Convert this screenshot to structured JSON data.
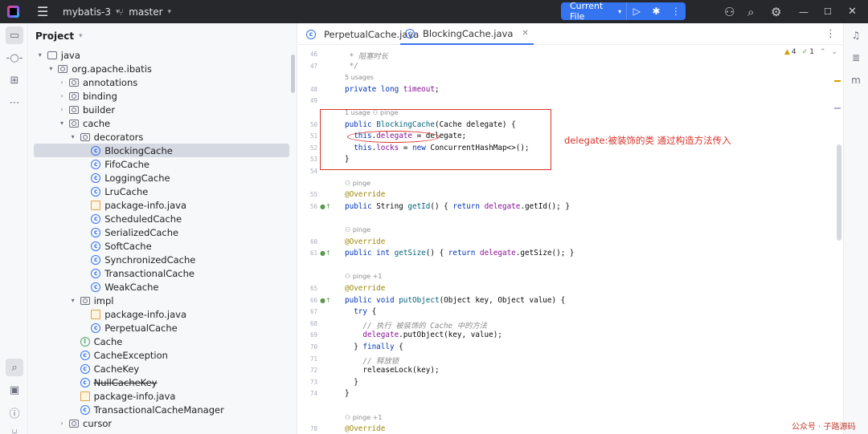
{
  "titlebar": {
    "project": "mybatis-3",
    "branch": "master",
    "run_config": "Current File"
  },
  "project_panel": {
    "title": "Project",
    "tree": [
      {
        "label": "java",
        "icon": "folder",
        "indent": 3,
        "arrow": "down"
      },
      {
        "label": "org.apache.ibatis",
        "icon": "pkg",
        "indent": 4,
        "arrow": "down"
      },
      {
        "label": "annotations",
        "icon": "pkg",
        "indent": 5,
        "arrow": "right"
      },
      {
        "label": "binding",
        "icon": "pkg",
        "indent": 5,
        "arrow": "right"
      },
      {
        "label": "builder",
        "icon": "pkg",
        "indent": 5,
        "arrow": "right"
      },
      {
        "label": "cache",
        "icon": "pkg",
        "indent": 5,
        "arrow": "down"
      },
      {
        "label": "decorators",
        "icon": "pkg",
        "indent": 6,
        "arrow": "down"
      },
      {
        "label": "BlockingCache",
        "icon": "cls",
        "indent": 7,
        "arrow": "",
        "selected": true
      },
      {
        "label": "FifoCache",
        "icon": "cls",
        "indent": 7,
        "arrow": ""
      },
      {
        "label": "LoggingCache",
        "icon": "cls",
        "indent": 7,
        "arrow": ""
      },
      {
        "label": "LruCache",
        "icon": "cls",
        "indent": 7,
        "arrow": ""
      },
      {
        "label": "package-info.java",
        "icon": "file",
        "indent": 7,
        "arrow": ""
      },
      {
        "label": "ScheduledCache",
        "icon": "cls",
        "indent": 7,
        "arrow": ""
      },
      {
        "label": "SerializedCache",
        "icon": "cls",
        "indent": 7,
        "arrow": ""
      },
      {
        "label": "SoftCache",
        "icon": "cls",
        "indent": 7,
        "arrow": ""
      },
      {
        "label": "SynchronizedCache",
        "icon": "cls",
        "indent": 7,
        "arrow": ""
      },
      {
        "label": "TransactionalCache",
        "icon": "cls",
        "indent": 7,
        "arrow": ""
      },
      {
        "label": "WeakCache",
        "icon": "cls",
        "indent": 7,
        "arrow": ""
      },
      {
        "label": "impl",
        "icon": "pkg",
        "indent": 6,
        "arrow": "down"
      },
      {
        "label": "package-info.java",
        "icon": "file",
        "indent": 7,
        "arrow": ""
      },
      {
        "label": "PerpetualCache",
        "icon": "cls",
        "indent": 7,
        "arrow": ""
      },
      {
        "label": "Cache",
        "icon": "intf",
        "indent": 6,
        "arrow": ""
      },
      {
        "label": "CacheException",
        "icon": "cls",
        "indent": 6,
        "arrow": ""
      },
      {
        "label": "CacheKey",
        "icon": "cls",
        "indent": 6,
        "arrow": ""
      },
      {
        "label": "NullCacheKey",
        "icon": "cls",
        "indent": 6,
        "arrow": "",
        "strike": true
      },
      {
        "label": "package-info.java",
        "icon": "file",
        "indent": 6,
        "arrow": ""
      },
      {
        "label": "TransactionalCacheManager",
        "icon": "cls",
        "indent": 6,
        "arrow": ""
      },
      {
        "label": "cursor",
        "icon": "pkg",
        "indent": 5,
        "arrow": "right"
      }
    ]
  },
  "tabs": [
    {
      "label": "PerpetualCache.java",
      "active": false
    },
    {
      "label": "BlockingCache.java",
      "active": true
    }
  ],
  "inspection": {
    "warnings": "4",
    "ok": "1"
  },
  "editor": {
    "lines": [
      {
        "no": "46",
        "hint": "",
        "html": "<span class=\"cm\"> * 阻塞时长</span>"
      },
      {
        "no": "47",
        "hint": "",
        "html": "<span class=\"cm\"> */</span>"
      },
      {
        "no": "",
        "hint": "5 usages",
        "html": ""
      },
      {
        "no": "48",
        "hint": "",
        "html": "<span class=\"kw\">private long</span> <span class=\"fld\">timeout</span>;"
      },
      {
        "no": "49",
        "hint": "",
        "html": ""
      },
      {
        "no": "",
        "hint": "1 usage   ⚇ pinge",
        "html": ""
      },
      {
        "no": "50",
        "hint": "",
        "html": "<span class=\"kw\">public</span> <span class=\"mth\">BlockingCache</span>(Cache delegate) {"
      },
      {
        "no": "51",
        "hint": "",
        "html": "  <span class=\"kw\">this</span>.<span class=\"fld\">delegate</span> = delegate;"
      },
      {
        "no": "52",
        "hint": "",
        "html": "  <span class=\"kw\">this</span>.<span class=\"fld\">locks</span> = <span class=\"kw\">new</span> ConcurrentHashMap&lt;&gt;();"
      },
      {
        "no": "53",
        "hint": "",
        "html": "}"
      },
      {
        "no": "54",
        "hint": "",
        "html": ""
      },
      {
        "no": "",
        "hint": "⚇ pinge",
        "html": ""
      },
      {
        "no": "55",
        "hint": "",
        "html": "<span class=\"ann\">@Override</span>"
      },
      {
        "no": "56",
        "hint": "",
        "icon": "●↑",
        "html": "<span class=\"kw\">public</span> String <span class=\"mth\">getId</span>() { <span class=\"kw\">return</span> <span class=\"fld\">delegate</span>.getId(); }"
      },
      {
        "no": "",
        "hint": "",
        "html": ""
      },
      {
        "no": "",
        "hint": "⚇ pinge",
        "html": ""
      },
      {
        "no": "60",
        "hint": "",
        "html": "<span class=\"ann\">@Override</span>"
      },
      {
        "no": "61",
        "hint": "",
        "icon": "●↑",
        "html": "<span class=\"kw\">public int</span> <span class=\"mth\">getSize</span>() { <span class=\"kw\">return</span> <span class=\"fld\">delegate</span>.getSize(); }"
      },
      {
        "no": "",
        "hint": "",
        "html": ""
      },
      {
        "no": "",
        "hint": "⚇ pinge +1",
        "html": ""
      },
      {
        "no": "65",
        "hint": "",
        "html": "<span class=\"ann\">@Override</span>"
      },
      {
        "no": "66",
        "hint": "",
        "icon": "●↑",
        "html": "<span class=\"kw\">public void</span> <span class=\"mth\">putObject</span>(Object key, Object value) {"
      },
      {
        "no": "67",
        "hint": "",
        "html": "  <span class=\"kw\">try</span> {"
      },
      {
        "no": "68",
        "hint": "",
        "html": "    <span class=\"cm\">// 执行 被装饰的 Cache 中的方法</span>"
      },
      {
        "no": "69",
        "hint": "",
        "html": "    <span class=\"fld\">delegate</span>.putObject(key, value);"
      },
      {
        "no": "70",
        "hint": "",
        "html": "  } <span class=\"kw\">finally</span> {"
      },
      {
        "no": "71",
        "hint": "",
        "html": "    <span class=\"cm\">// 释放锁</span>"
      },
      {
        "no": "72",
        "hint": "",
        "html": "    releaseLock(key);"
      },
      {
        "no": "73",
        "hint": "",
        "html": "  }"
      },
      {
        "no": "74",
        "hint": "",
        "html": "}"
      },
      {
        "no": "",
        "hint": "",
        "html": ""
      },
      {
        "no": "",
        "hint": "⚇ pinge +1",
        "html": ""
      },
      {
        "no": "78",
        "hint": "",
        "html": "<span class=\"ann\">@Override</span>"
      }
    ]
  },
  "annotation_note": "delegate:被装饰的类 通过构造方法传入",
  "watermark": "公众号 · 子路源码",
  "colors": {
    "accent": "#3574f0",
    "annotation": "#d9342b"
  }
}
